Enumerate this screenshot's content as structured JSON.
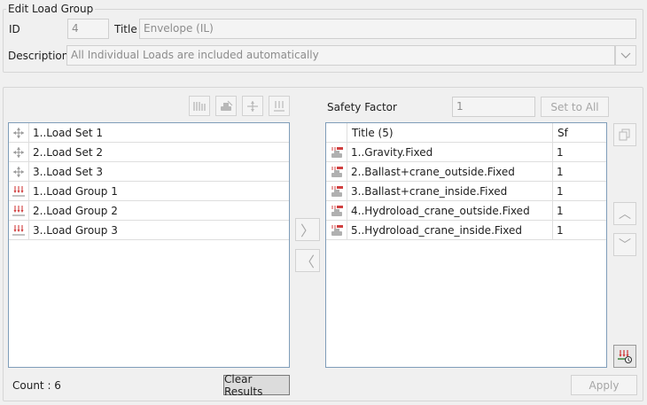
{
  "edit_group": {
    "legend": "Edit Load Group",
    "id_label": "ID",
    "id_value": "4",
    "title_label": "Title",
    "title_value": "Envelope (IL)",
    "description_label": "Description",
    "description_value": "All Individual Loads are included automatically"
  },
  "left_toolbar": {
    "icons": [
      "stacked-loads-icon",
      "crane-icon",
      "load-set-icon",
      "load-group-icon"
    ]
  },
  "left_list": {
    "items": [
      {
        "label": "1..Load Set 1",
        "icon": "load-set-icon"
      },
      {
        "label": "2..Load Set 2",
        "icon": "load-set-icon"
      },
      {
        "label": "3..Load Set 3",
        "icon": "load-set-icon"
      },
      {
        "label": "1..Load Group 1",
        "icon": "load-group-icon"
      },
      {
        "label": "2..Load Group 2",
        "icon": "load-group-icon"
      },
      {
        "label": "3..Load Group 3",
        "icon": "load-group-icon"
      }
    ],
    "count_text": "Count : 6",
    "clear_button": "Clear Results"
  },
  "move": {
    "right_glyph": "〉",
    "left_glyph": "〈"
  },
  "safety": {
    "label": "Safety Factor",
    "value": "1",
    "set_all_button": "Set to All"
  },
  "right_table": {
    "col_title": "Title (5)",
    "col_sf": "Sf",
    "rows": [
      {
        "title": "1..Gravity.Fixed",
        "sf": "1"
      },
      {
        "title": "2..Ballast+crane_outside.Fixed",
        "sf": "1"
      },
      {
        "title": "3..Ballast+crane_inside.Fixed",
        "sf": "1"
      },
      {
        "title": "4..Hydroload_crane_outside.Fixed",
        "sf": "1"
      },
      {
        "title": "5..Hydroload_crane_inside.Fixed",
        "sf": "1"
      }
    ]
  },
  "side_buttons": {
    "up_glyph": "︿",
    "down_glyph": "﹀"
  },
  "apply_button": "Apply",
  "colors": {
    "load_set": "#9a9a9a",
    "load_group": "#d04040",
    "accent_border": "#7f9db9"
  }
}
